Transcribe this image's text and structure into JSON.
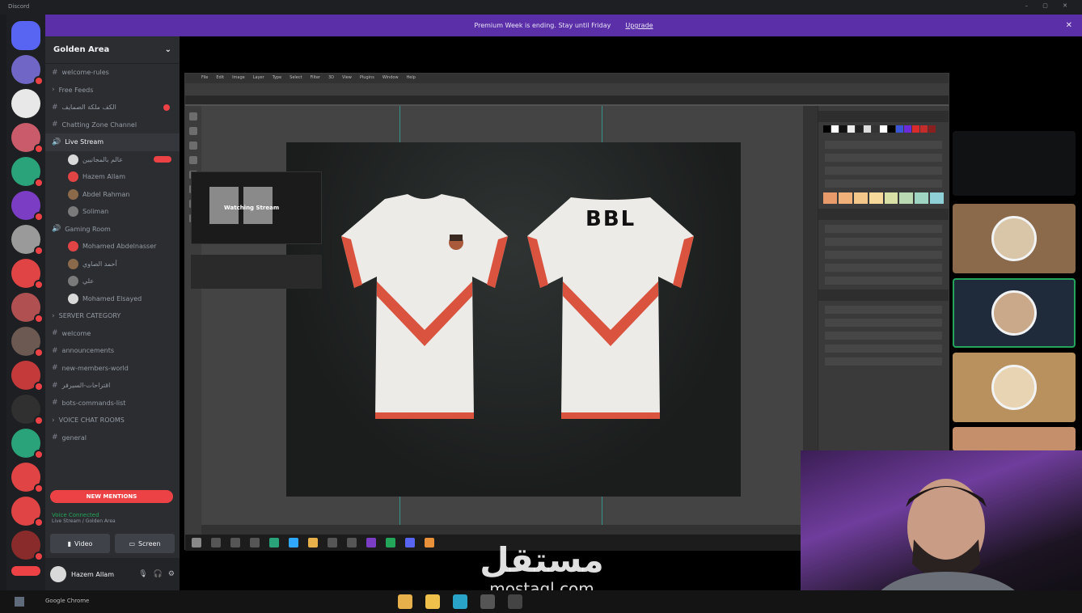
{
  "window": {
    "title": "Discord"
  },
  "banner": {
    "message": "Premium Week is ending. Stay until Friday",
    "action": "Upgrade"
  },
  "server": {
    "name": "Golden Area"
  },
  "channels": [
    {
      "label": "welcome-rules",
      "type": "text"
    },
    {
      "label": "Free Feeds",
      "type": "category"
    },
    {
      "label": "الكف ملكة الصمايف",
      "type": "text"
    },
    {
      "label": "Chatting Zone Channel",
      "type": "text"
    },
    {
      "label": "Live Stream",
      "type": "voice"
    },
    {
      "label": "عالم بالمجانيين",
      "type": "member",
      "tag": "LIVE"
    },
    {
      "label": "Hazem Allam",
      "type": "member"
    },
    {
      "label": "Abdel Rahman",
      "type": "member"
    },
    {
      "label": "Soliman",
      "type": "member"
    },
    {
      "label": "Gaming Room",
      "type": "voice"
    },
    {
      "label": "Mohamed Abdelnasser",
      "type": "member"
    },
    {
      "label": "أحمد الصاوي",
      "type": "member"
    },
    {
      "label": "علي",
      "type": "member"
    },
    {
      "label": "Mohamed Elsayed",
      "type": "member"
    },
    {
      "label": "SERVER CATEGORY",
      "type": "category"
    },
    {
      "label": "welcome",
      "type": "text"
    },
    {
      "label": "announcements",
      "type": "text"
    },
    {
      "label": "new-members-world",
      "type": "text"
    },
    {
      "label": "اقتراحات-السيرفر",
      "type": "text"
    },
    {
      "label": "bots-commands-list",
      "type": "text"
    },
    {
      "label": "VOICE CHAT ROOMS",
      "type": "category"
    },
    {
      "label": "general",
      "type": "text"
    }
  ],
  "new_mentions": "NEW MENTIONS",
  "voice_status": {
    "title": "Voice Connected",
    "subtitle": "Live Stream / Golden Area"
  },
  "voice_controls": {
    "video": "Video",
    "screen": "Screen"
  },
  "user": {
    "name": "Hazem Allam"
  },
  "stream": {
    "screen_share_label": "Watching Stream",
    "back_shirt_logo": "BBL",
    "app": "Photoshop",
    "menu": [
      "File",
      "Edit",
      "Image",
      "Layer",
      "Type",
      "Select",
      "Filter",
      "3D",
      "View",
      "Plugins",
      "Window",
      "Help"
    ]
  },
  "os_taskbar": {
    "label": "Google Chrome"
  },
  "watermark": {
    "arabic": "مستقل",
    "latin": "mostaql.com"
  },
  "colors": {
    "banner": "#5b2fa8",
    "danger": "#ed4245",
    "discord_green": "#23a55a",
    "shirt_stripe": "#d9533f"
  }
}
